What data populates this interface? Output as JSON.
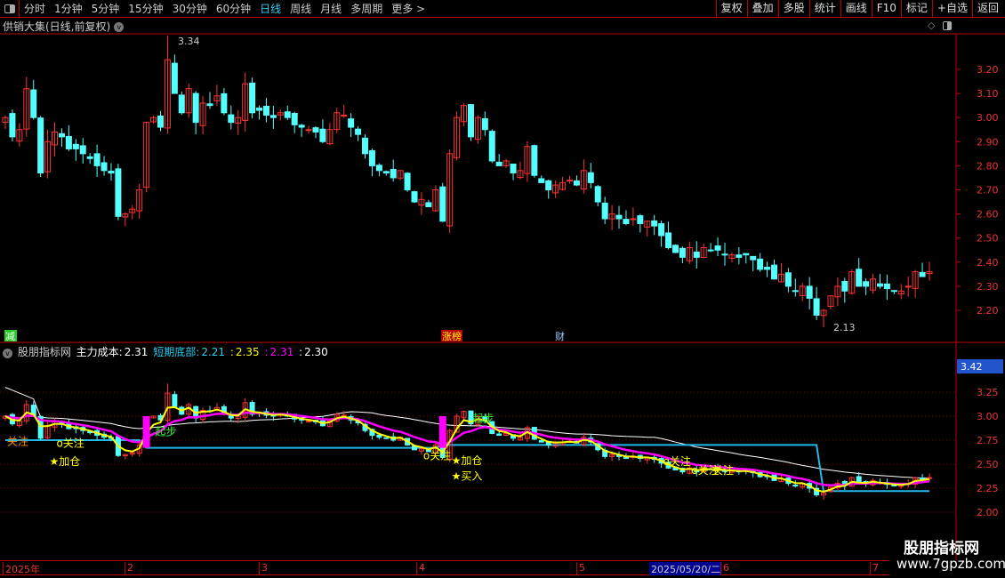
{
  "toolbar": {
    "periods": [
      "分时",
      "1分钟",
      "5分钟",
      "15分钟",
      "30分钟",
      "60分钟",
      "日线",
      "周线",
      "月线",
      "多周期",
      "更多 >"
    ],
    "active": "日线",
    "buttons": [
      "复权",
      "叠加",
      "多股",
      "统计",
      "画线",
      "F10",
      "标记",
      "+自选",
      "返回"
    ]
  },
  "title": "供销大集(日线,前复权)",
  "markers": {
    "high": "3.34",
    "low": "2.13",
    "tags": [
      "减",
      "涨榜",
      "财"
    ]
  },
  "indicator": {
    "name": "股朋指标网",
    "label1": "主力成本:",
    "v1": "2.31",
    "label2": "短期底部:",
    "v2": "2.21",
    "v3": "2.35",
    "v4": "2.31",
    "v5": "2.30",
    "sep": ":",
    "cursor_value": "3.42",
    "signals": [
      "加仓",
      "关注",
      "关注",
      "起步",
      "关注",
      "加仓",
      "买入",
      "起步",
      "关注",
      "关注",
      "关注"
    ]
  },
  "dates": {
    "labels": [
      "2025年",
      "2",
      "3",
      "4",
      "5",
      "6",
      "7"
    ],
    "selected": "2025/05/20/二"
  },
  "watermark": {
    "line1": "股朋指标网",
    "line2": "www.7gpzb.com"
  },
  "colors": {
    "up": "#ff3232",
    "down": "#54ffff",
    "ma": "#ff00ff",
    "fast": "#ffff00",
    "slow": "#ffffff",
    "base": "#22b8e8"
  },
  "chart_data": {
    "type": "candlestick",
    "price_axis": [
      "3.20",
      "3.10",
      "3.00",
      "2.90",
      "2.80",
      "2.70",
      "2.60",
      "2.50",
      "2.40",
      "2.30",
      "2.20"
    ],
    "ind_axis": [
      "3.25",
      "3.00",
      "2.75",
      "2.50",
      "2.25",
      "2.00"
    ],
    "closes": [
      3.0,
      2.92,
      2.95,
      3.12,
      3.0,
      2.77,
      2.9,
      2.94,
      2.92,
      2.87,
      2.87,
      2.85,
      2.83,
      2.8,
      2.78,
      2.77,
      2.59,
      2.6,
      2.62,
      2.7,
      2.98,
      3.0,
      2.96,
      3.24,
      3.1,
      3.02,
      3.12,
      2.98,
      3.06,
      3.05,
      3.09,
      3.02,
      2.98,
      3.0,
      3.14,
      3.02,
      3.03,
      3.01,
      3.0,
      3.02,
      3.0,
      2.97,
      2.96,
      2.95,
      2.94,
      2.9,
      2.95,
      3.02,
      3.01,
      2.96,
      2.93,
      2.85,
      2.8,
      2.78,
      2.77,
      2.75,
      2.78,
      2.7,
      2.65,
      2.66,
      2.63,
      2.7,
      2.57,
      2.85,
      3.0,
      3.05,
      2.92,
      3.0,
      2.95,
      2.82,
      2.8,
      2.82,
      2.77,
      2.78,
      2.88,
      2.76,
      2.73,
      2.7,
      2.72,
      2.73,
      2.74,
      2.72,
      2.78,
      2.73,
      2.65,
      2.58,
      2.6,
      2.58,
      2.56,
      2.58,
      2.56,
      2.57,
      2.55,
      2.51,
      2.46,
      2.44,
      2.42,
      2.46,
      2.42,
      2.46,
      2.45,
      2.45,
      2.43,
      2.43,
      2.42,
      2.43,
      2.41,
      2.37,
      2.37,
      2.33,
      2.35,
      2.3,
      2.28,
      2.3,
      2.25,
      2.18,
      2.2,
      2.26,
      2.3,
      2.28,
      2.36,
      2.3,
      2.3,
      2.33,
      2.3,
      2.29,
      2.28,
      2.28,
      2.3,
      2.36,
      2.34,
      2.36
    ]
  }
}
